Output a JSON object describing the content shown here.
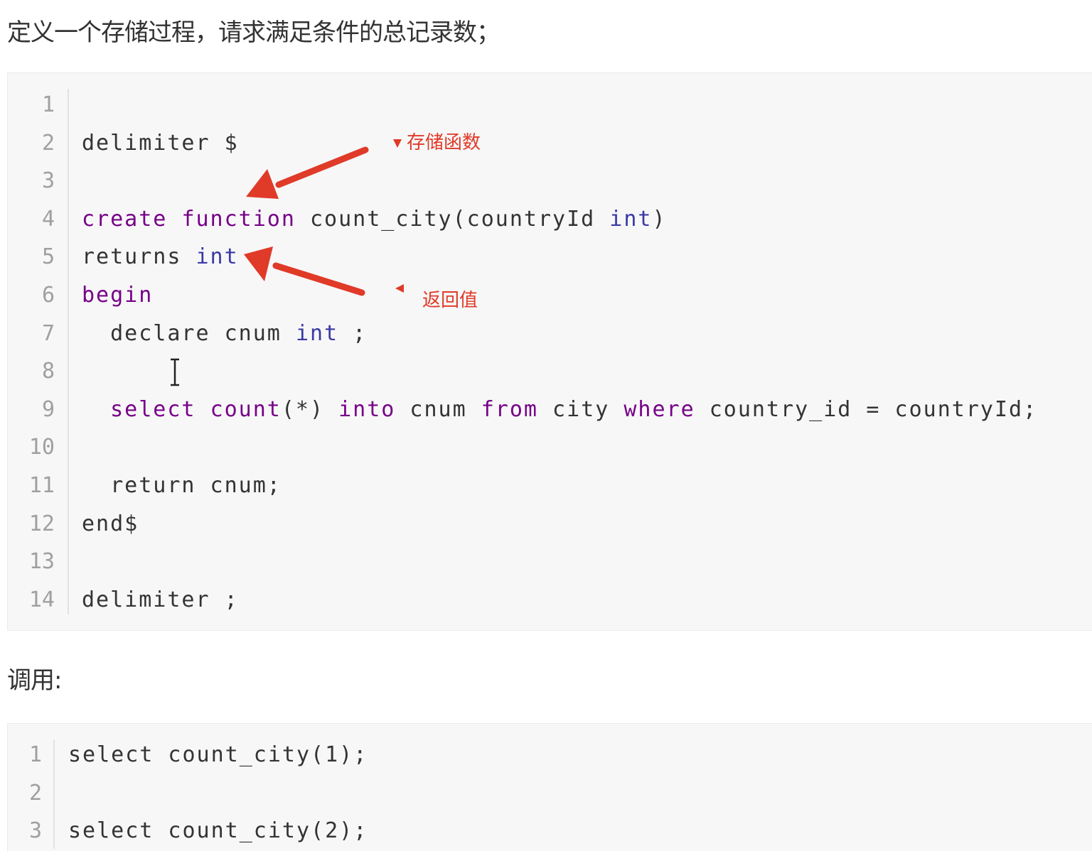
{
  "heading": "定义一个存储过程，请求满足条件的总记录数；",
  "call_heading": "调用:",
  "annotations": {
    "color": "#e03a28",
    "function_label": "存储函数",
    "return_label": "返回值"
  },
  "code_block_1": {
    "lines": [
      {
        "n": "1",
        "parts": []
      },
      {
        "n": "2",
        "parts": [
          {
            "t": "delimiter $",
            "c": "plain"
          }
        ]
      },
      {
        "n": "3",
        "parts": []
      },
      {
        "n": "4",
        "parts": [
          {
            "t": "create",
            "c": "kw"
          },
          {
            "t": " ",
            "c": "plain"
          },
          {
            "t": "function",
            "c": "kw"
          },
          {
            "t": " count_city(countryId ",
            "c": "plain"
          },
          {
            "t": "int",
            "c": "type"
          },
          {
            "t": ")",
            "c": "plain"
          }
        ]
      },
      {
        "n": "5",
        "parts": [
          {
            "t": "returns ",
            "c": "plain"
          },
          {
            "t": "int",
            "c": "type"
          }
        ]
      },
      {
        "n": "6",
        "parts": [
          {
            "t": "begin",
            "c": "kw"
          }
        ]
      },
      {
        "n": "7",
        "parts": [
          {
            "t": "  declare cnum ",
            "c": "plain"
          },
          {
            "t": "int",
            "c": "type"
          },
          {
            "t": " ;",
            "c": "plain"
          }
        ]
      },
      {
        "n": "8",
        "parts": []
      },
      {
        "n": "9",
        "parts": [
          {
            "t": "  select",
            "c": "kw"
          },
          {
            "t": " ",
            "c": "plain"
          },
          {
            "t": "count",
            "c": "kw"
          },
          {
            "t": "(*) ",
            "c": "plain"
          },
          {
            "t": "into",
            "c": "kw"
          },
          {
            "t": " cnum ",
            "c": "plain"
          },
          {
            "t": "from",
            "c": "kw"
          },
          {
            "t": " city ",
            "c": "plain"
          },
          {
            "t": "where",
            "c": "kw"
          },
          {
            "t": " country_id = countryId;",
            "c": "plain"
          }
        ]
      },
      {
        "n": "10",
        "parts": []
      },
      {
        "n": "11",
        "parts": [
          {
            "t": "  return cnum;",
            "c": "plain"
          }
        ]
      },
      {
        "n": "12",
        "parts": [
          {
            "t": "end$",
            "c": "plain"
          }
        ]
      },
      {
        "n": "13",
        "parts": []
      },
      {
        "n": "14",
        "parts": [
          {
            "t": "delimiter ;",
            "c": "plain"
          }
        ]
      }
    ]
  },
  "code_block_2": {
    "lines": [
      {
        "n": "1",
        "parts": [
          {
            "t": "select count_city(1);",
            "c": "plain"
          }
        ]
      },
      {
        "n": "2",
        "parts": []
      },
      {
        "n": "3",
        "parts": [
          {
            "t": "select count_city(2);",
            "c": "plain"
          }
        ]
      }
    ]
  }
}
